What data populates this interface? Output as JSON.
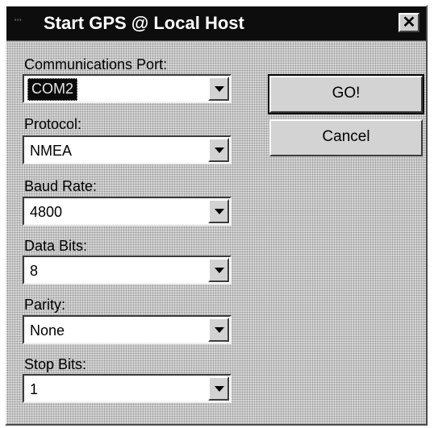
{
  "window": {
    "title": "Start GPS @ Local Host",
    "close_glyph": "✕"
  },
  "fields": [
    {
      "label": "Communications Port:",
      "value": "COM2",
      "selected": true
    },
    {
      "label": "Protocol:",
      "value": "NMEA"
    },
    {
      "label": "Baud Rate:",
      "value": "4800"
    },
    {
      "label": "Data Bits:",
      "value": "8"
    },
    {
      "label": "Parity:",
      "value": "None"
    },
    {
      "label": "Stop Bits:",
      "value": "1"
    }
  ],
  "buttons": {
    "go_label": "GO!",
    "cancel_label": "Cancel"
  },
  "icons": {
    "close": "close-icon",
    "dropdown": "chevron-down-icon"
  }
}
